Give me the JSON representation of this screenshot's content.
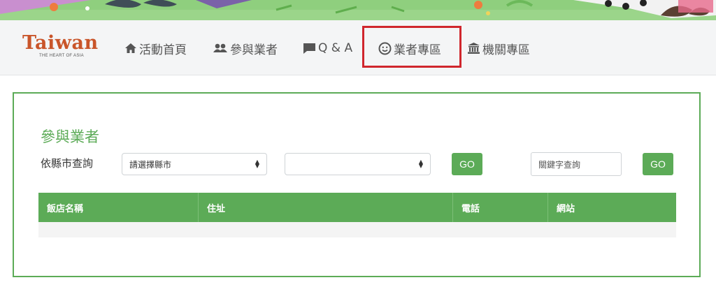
{
  "banner": {
    "description_icon": "illustrated-grass-banner"
  },
  "logo": {
    "word": "Taiwan",
    "tagline": "THE HEART OF ASIA"
  },
  "nav": {
    "items": [
      {
        "label": "活動首頁",
        "icon": "home-icon"
      },
      {
        "label": "參與業者",
        "icon": "users-icon"
      },
      {
        "label": "Q & A",
        "icon": "comment-icon"
      },
      {
        "label": "業者專區",
        "icon": "smile-icon"
      },
      {
        "label": "機關專區",
        "icon": "institution-icon"
      }
    ]
  },
  "panel": {
    "title": "參與業者",
    "query_label": "依縣市查詢",
    "city_select": {
      "value": "請選擇縣市"
    },
    "district_select": {
      "value": ""
    },
    "go_label": "GO",
    "keyword": {
      "placeholder": "關鍵字查詢"
    },
    "go2_label": "GO",
    "table": {
      "columns": [
        "飯店名稱",
        "住址",
        "電話",
        "網站"
      ],
      "rows": []
    }
  },
  "colors": {
    "accent": "#5cab57",
    "highlight": "#d0262d",
    "logo": "#c9552a"
  }
}
